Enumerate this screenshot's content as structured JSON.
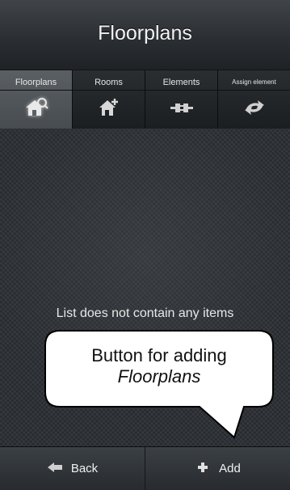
{
  "header": {
    "title": "Floorplans"
  },
  "tabs": [
    {
      "label": "Floorplans",
      "icon": "house-network-icon",
      "active": true
    },
    {
      "label": "Rooms",
      "icon": "house-add-icon",
      "active": false
    },
    {
      "label": "Elements",
      "icon": "connector-icon",
      "active": false
    },
    {
      "label": "Assign element",
      "icon": "assign-arrows-icon",
      "active": false
    }
  ],
  "content": {
    "empty_text": "List does not contain any items"
  },
  "callout": {
    "line1": "Button for adding",
    "line2": "Floorplans"
  },
  "bottom_bar": {
    "back_label": "Back",
    "add_label": "Add"
  }
}
